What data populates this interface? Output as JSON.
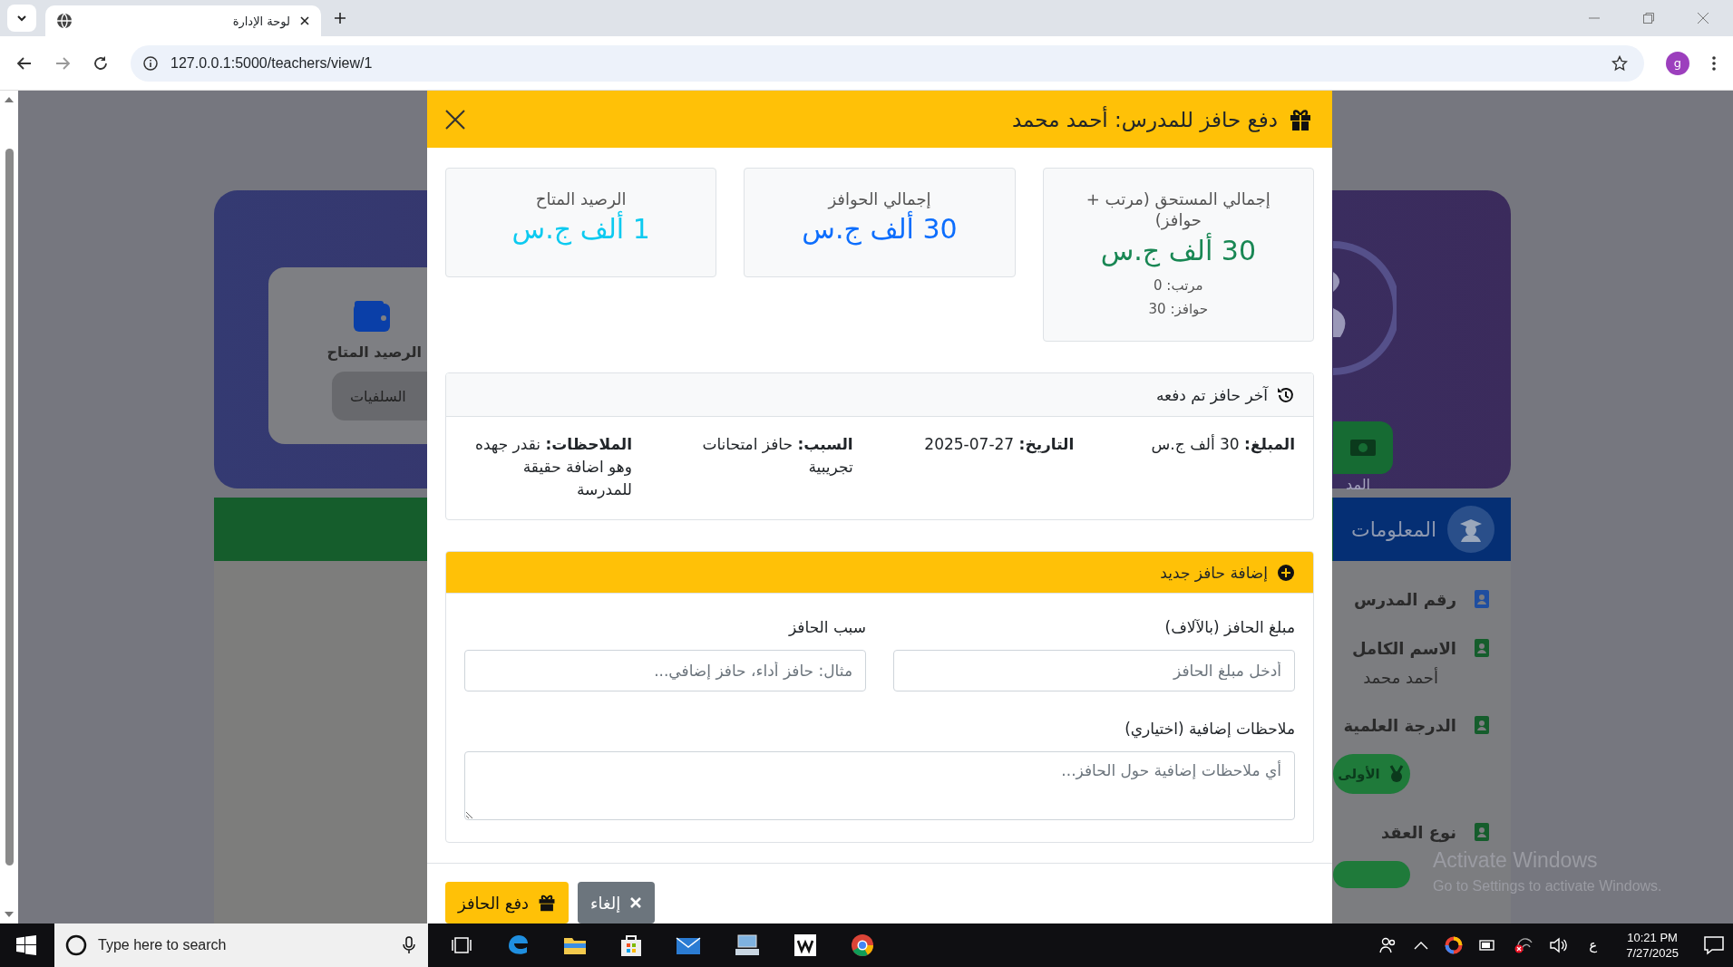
{
  "browser": {
    "tab_title": "لوحة الإدارة",
    "url": "127.0.0.1:5000/teachers/view/1",
    "profile": "g"
  },
  "background": {
    "balance_label": "الرصيد المتاح",
    "advances_button": "السلفيات",
    "school_fragment": "المد",
    "info_title": "المعلومات",
    "info_items": [
      {
        "kind": "field",
        "label": "رقم المدرس"
      },
      {
        "kind": "field",
        "label": "الاسم الكامل",
        "value": "أحمد محمد"
      },
      {
        "kind": "field",
        "label": "الدرجة العلمية"
      },
      {
        "kind": "pill",
        "label": "الأولى"
      },
      {
        "kind": "field",
        "label": "نوع العقد"
      },
      {
        "kind": "pill_cut"
      }
    ]
  },
  "modal": {
    "title": "دفع حافز للمدرس: أحمد محمد",
    "stats": [
      {
        "label": "إجمالي المستحق (مرتب + حوافز)",
        "value": "30 ألف ج.س",
        "color": "#198754",
        "details": [
          "مرتب: 0",
          "حوافز: 30"
        ]
      },
      {
        "label": "إجمالي الحوافز",
        "value": "30 ألف ج.س",
        "color": "#0d6efd"
      },
      {
        "label": "الرصيد المتاح",
        "value": "1 ألف ج.س",
        "color": "#0dcaf0"
      }
    ],
    "last_bonus": {
      "title": "آخر حافز تم دفعه",
      "fields": [
        "**المبلغ:** 30 ألف ج.س",
        "**التاريخ:** 27-07-2025",
        "**السبب:** حافز امتحانات تجريبية",
        "**الملاحظات:** نقدر جهده وهو اضافة حقيقة للمدرسة"
      ]
    },
    "new_bonus": {
      "title": "إضافة حافز جديد",
      "fields": [
        {
          "label": "مبلغ الحافز (بالآلاف)",
          "placeholder": "أدخل مبلغ الحافز"
        },
        {
          "label": "سبب الحافز",
          "placeholder": "مثال: حافز أداء، حافز إضافي..."
        }
      ],
      "notes": {
        "label": "ملاحظات إضافية (اختياري)",
        "placeholder": "أي ملاحظات إضافية حول الحافز..."
      }
    },
    "buttons": [
      {
        "kind": "secondary",
        "label": "إلغاء"
      },
      {
        "kind": "primary",
        "label": "دفع الحافز"
      }
    ]
  },
  "activation": {
    "title": "Activate Windows",
    "subtitle": "Go to Settings to activate Windows."
  },
  "taskbar": {
    "search_placeholder": "Type here to search",
    "language": "ع",
    "time": "10:21 PM",
    "date": "7/27/2025"
  }
}
